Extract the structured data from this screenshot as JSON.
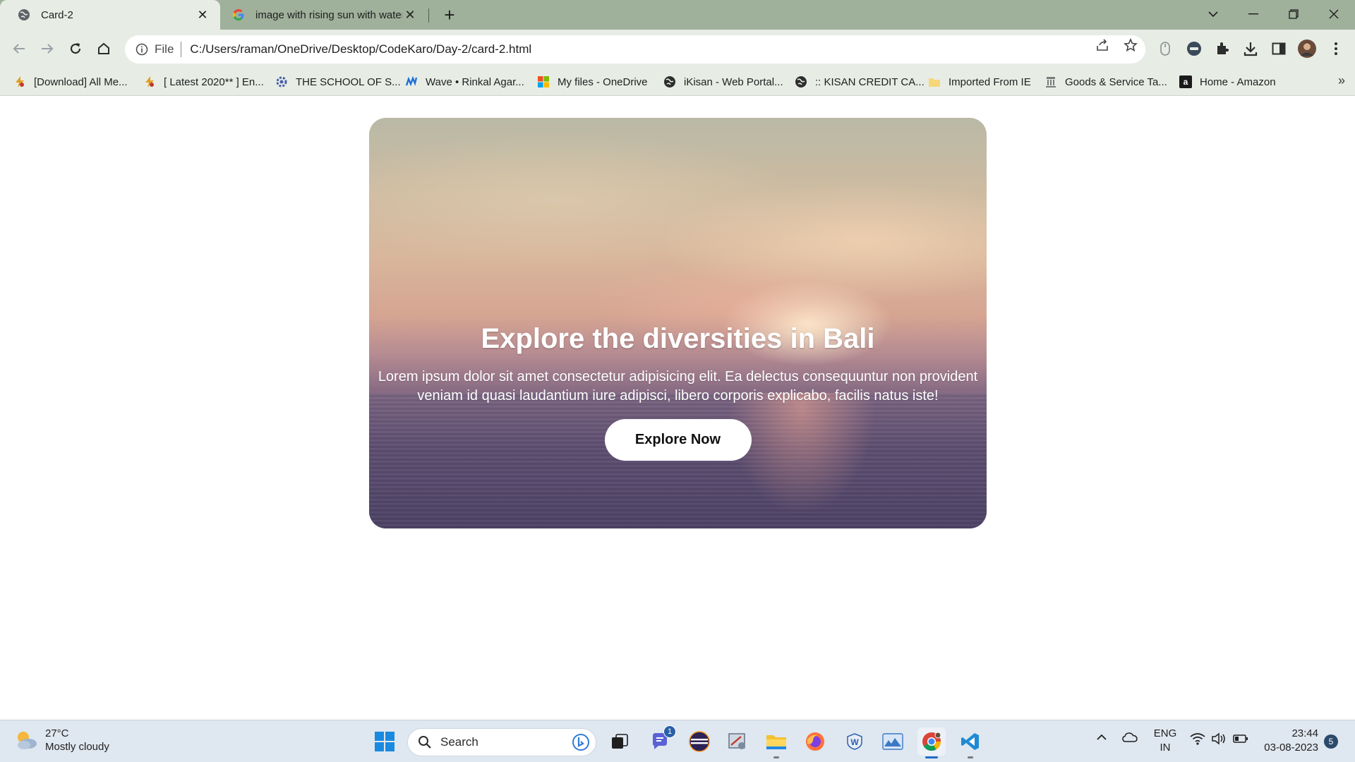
{
  "tabs": [
    {
      "title": "Card-2",
      "active": true,
      "favicon": "globe-icon"
    },
    {
      "title": "image with rising sun with water",
      "active": false,
      "favicon": "google-icon"
    }
  ],
  "address": {
    "scheme_label": "File",
    "url": "C:/Users/raman/OneDrive/Desktop/CodeKaro/Day-2/card-2.html"
  },
  "bookmarks": [
    {
      "label": "[Download] All Me...",
      "icon": "bolt-icon"
    },
    {
      "label": "[ Latest 2020** ] En...",
      "icon": "bolt-icon"
    },
    {
      "label": "THE SCHOOL OF S...",
      "icon": "gear-icon"
    },
    {
      "label": "Wave • Rinkal Agar...",
      "icon": "wave-icon"
    },
    {
      "label": "My files - OneDrive",
      "icon": "microsoft-icon"
    },
    {
      "label": "iKisan - Web Portal...",
      "icon": "globe-icon"
    },
    {
      "label": ":: KISAN CREDIT CA...",
      "icon": "globe-icon"
    },
    {
      "label": "Imported From IE",
      "icon": "folder-icon"
    },
    {
      "label": "Goods & Service Ta...",
      "icon": "emblem-icon"
    },
    {
      "label": "Home - Amazon",
      "icon": "amazon-icon"
    }
  ],
  "bookmarks_more": "»",
  "card": {
    "heading": "Explore the diversities in Bali",
    "body": "Lorem ipsum dolor sit amet consectetur adipisicing elit. Ea delectus consequuntur non provident veniam id quasi laudantium iure adipisci, libero corporis explicabo, facilis natus iste!",
    "button_label": "Explore Now"
  },
  "taskbar": {
    "weather_temp": "27°C",
    "weather_desc": "Mostly cloudy",
    "search_placeholder": "Search",
    "chat_badge": "1",
    "lang_line1": "ENG",
    "lang_line2": "IN",
    "time": "23:44",
    "date": "03-08-2023",
    "notifications": "5"
  },
  "colors": {
    "tabstrip": "#9fb09b",
    "toolbar": "#e7ede5",
    "taskbar": "#dfe7f0",
    "accent": "#1d6dc8"
  }
}
